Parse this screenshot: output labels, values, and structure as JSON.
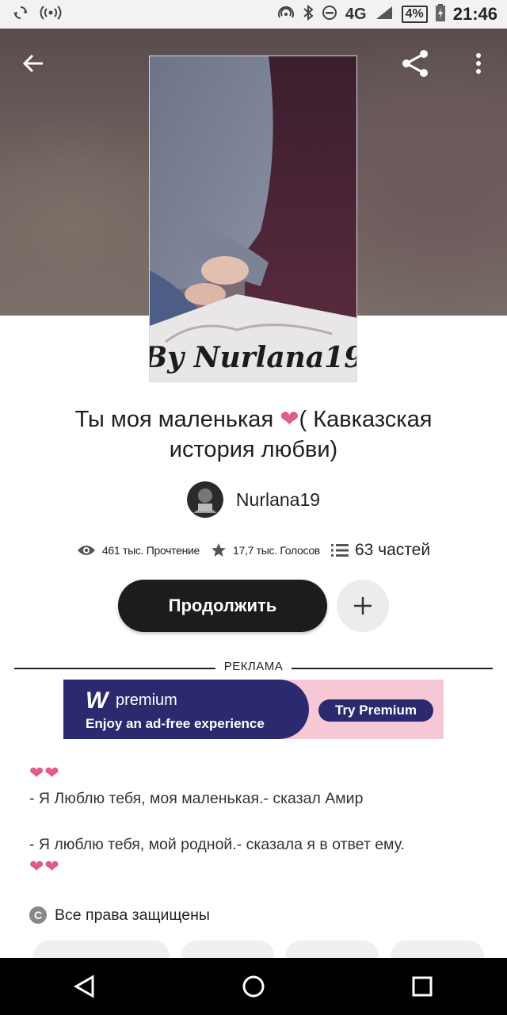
{
  "status_bar": {
    "network": "4G",
    "network_small": "4G",
    "battery": "4%",
    "time": "21:46",
    "icons": [
      "sync-icon",
      "hotspot-icon",
      "nfc-icon",
      "bluetooth-icon",
      "dnd-icon",
      "signal-icon",
      "battery-icon"
    ]
  },
  "header": {
    "back_icon": "arrow-left-icon",
    "share_icon": "share-icon",
    "more_icon": "more-vertical-icon",
    "cover_caption": "By Nurlana19"
  },
  "story": {
    "title_part1": "Ты моя маленькая ",
    "title_heart": "❤",
    "title_part2": "( Кавказская история любви)",
    "author": "Nurlana19",
    "reads": "461 тыс. Прочтение",
    "votes": "17,7 тыс. Голосов",
    "parts": "63 частей",
    "continue_label": "Продолжить"
  },
  "ad": {
    "label": "РЕКЛАМА",
    "brand_letter": "W",
    "brand_word": "premium",
    "subtitle": "Enjoy an ad-free experience",
    "cta": "Try Premium"
  },
  "description": {
    "hearts_top": "❤❤",
    "line1": "- Я Люблю тебя, моя маленькая.- сказал Амир",
    "line2": "- Я люблю тебя, мой родной.- сказала я в ответ ему.",
    "hearts_bottom": "❤❤"
  },
  "copyright": {
    "symbol": "C",
    "text": "Все права защищены"
  },
  "colors": {
    "accent_heart": "#e25b8f",
    "continue_bg": "#1e1b1d",
    "ad_dark": "#2b2a6e",
    "ad_pink": "#f6c8d6"
  }
}
